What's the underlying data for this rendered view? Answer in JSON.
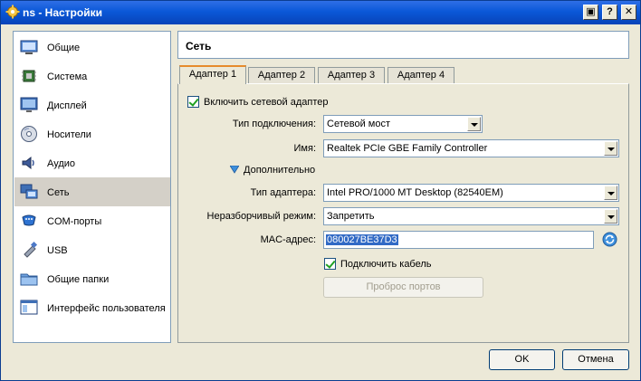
{
  "window": {
    "title": "ns - Настройки"
  },
  "sidebar": {
    "items": [
      {
        "label": "Общие",
        "icon": "general-icon"
      },
      {
        "label": "Система",
        "icon": "system-chip-icon"
      },
      {
        "label": "Дисплей",
        "icon": "display-icon"
      },
      {
        "label": "Носители",
        "icon": "storage-disc-icon"
      },
      {
        "label": "Аудио",
        "icon": "audio-speaker-icon"
      },
      {
        "label": "Сеть",
        "icon": "network-icon"
      },
      {
        "label": "COM-порты",
        "icon": "serial-port-icon"
      },
      {
        "label": "USB",
        "icon": "usb-icon"
      },
      {
        "label": "Общие папки",
        "icon": "shared-folder-icon"
      },
      {
        "label": "Интерфейс пользователя",
        "icon": "user-interface-icon"
      }
    ],
    "selected": "Сеть"
  },
  "page": {
    "title": "Сеть"
  },
  "tabs": [
    "Адаптер 1",
    "Адаптер 2",
    "Адаптер 3",
    "Адаптер 4"
  ],
  "adapter": {
    "enable_label": "Включить сетевой адаптер",
    "attached_label": "Тип подключения:",
    "attached_value": "Сетевой мост",
    "name_label": "Имя:",
    "name_value": "Realtek PCIe GBE Family Controller",
    "advanced_label": "Дополнительно",
    "type_label": "Тип адаптера:",
    "type_value": "Intel PRO/1000 MT Desktop (82540EM)",
    "promisc_label": "Неразборчивый режим:",
    "promisc_value": "Запретить",
    "mac_label": "MAC-адрес:",
    "mac_value": "080027BE37D3",
    "cable_label": "Подключить кабель",
    "port_forward_label": "Проброс портов"
  },
  "footer": {
    "ok_label": "OK",
    "cancel_label": "Отмена"
  },
  "colors": {
    "titlebar": "#0a58d8",
    "window_bg": "#ece9d8",
    "selection": "#316ac5"
  }
}
